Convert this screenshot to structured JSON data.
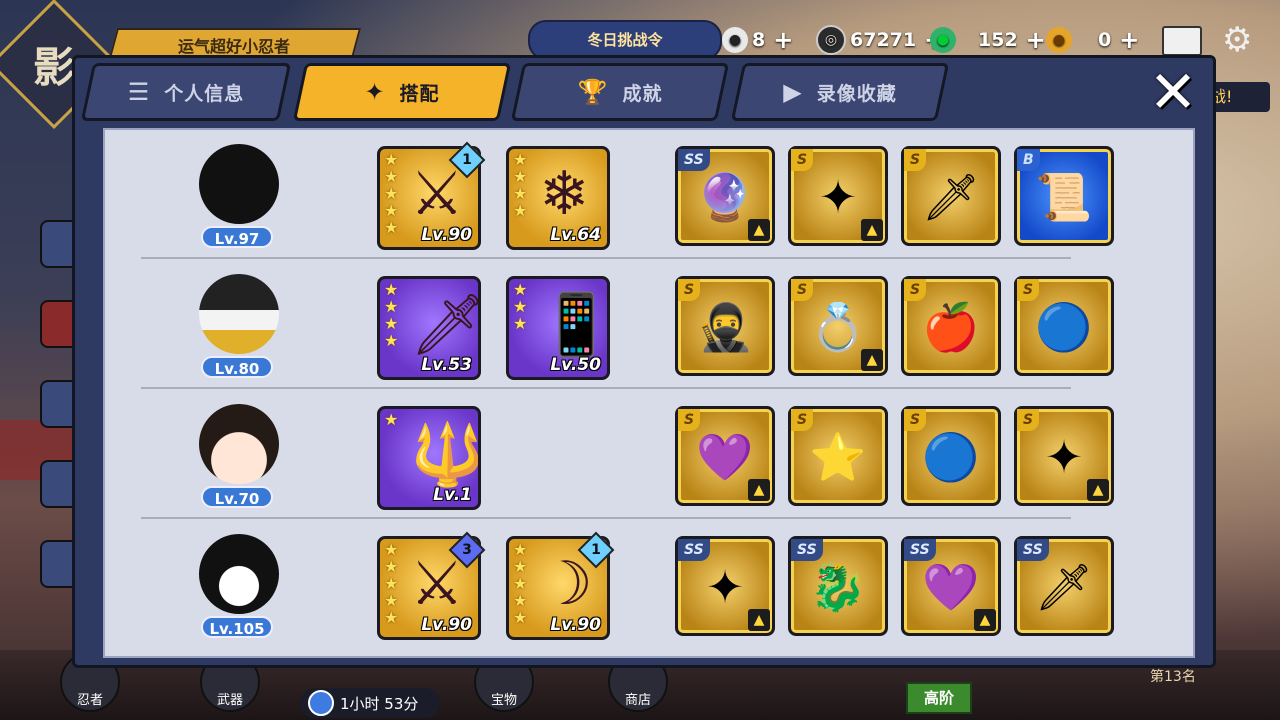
{
  "hud": {
    "logo_char": "影",
    "player_title": "运气超好小忍者",
    "event_label": "冬日挑战令",
    "resources": [
      {
        "name": "rice-ball",
        "value": "8",
        "color": "#f2f2f2"
      },
      {
        "name": "coin",
        "value": "67271",
        "color": "#333333"
      },
      {
        "name": "jade",
        "value": "152",
        "color": "#2fb36a"
      },
      {
        "name": "map-pin",
        "value": "0",
        "color": "#e6a52a"
      }
    ],
    "battle_text": "战!",
    "timer_text": "1小时 53分",
    "advanced_label": "高阶",
    "rank_text": "第13名",
    "bottom_tabs": [
      "忍者",
      "武器",
      "宝物",
      "商店"
    ]
  },
  "tabs": [
    {
      "label": "个人信息",
      "icon": "profile-icon",
      "active": false
    },
    {
      "label": "搭配",
      "icon": "shuriken-icon",
      "active": true
    },
    {
      "label": "成就",
      "icon": "trophy-icon",
      "active": false
    },
    {
      "label": "录像收藏",
      "icon": "play-icon",
      "active": false
    }
  ],
  "rows": [
    {
      "level": "Lv.97",
      "weapons": [
        {
          "stars": 5,
          "level": "Lv.90",
          "rarity": "gold",
          "gem": "1",
          "gem_color": "#6fd0ff",
          "art": "⚔"
        },
        {
          "stars": 4,
          "level": "Lv.64",
          "rarity": "gold",
          "gem": "",
          "gem_color": "",
          "art": "❄"
        }
      ],
      "treasures": [
        {
          "rank": "SS",
          "art": "🔮",
          "blue": false,
          "badge": true
        },
        {
          "rank": "S",
          "art": "✦",
          "blue": false,
          "badge": true
        },
        {
          "rank": "S",
          "art": "🗡",
          "blue": false,
          "badge": false
        },
        {
          "rank": "B",
          "art": "📜",
          "blue": true,
          "badge": false
        }
      ]
    },
    {
      "level": "Lv.80",
      "weapons": [
        {
          "stars": 4,
          "level": "Lv.53",
          "rarity": "purple",
          "gem": "",
          "gem_color": "",
          "art": "🗡"
        },
        {
          "stars": 3,
          "level": "Lv.50",
          "rarity": "purple",
          "gem": "",
          "gem_color": "",
          "art": "📱"
        }
      ],
      "treasures": [
        {
          "rank": "S",
          "art": "🥷",
          "blue": false,
          "badge": false
        },
        {
          "rank": "S",
          "art": "💍",
          "blue": false,
          "badge": true
        },
        {
          "rank": "S",
          "art": "🍎",
          "blue": false,
          "badge": false
        },
        {
          "rank": "S",
          "art": "🔵",
          "blue": false,
          "badge": false
        }
      ]
    },
    {
      "level": "Lv.70",
      "weapons": [
        {
          "stars": 1,
          "level": "Lv.1",
          "rarity": "purple",
          "gem": "",
          "gem_color": "",
          "art": "🔱"
        }
      ],
      "treasures": [
        {
          "rank": "S",
          "art": "💜",
          "blue": false,
          "badge": true
        },
        {
          "rank": "S",
          "art": "⭐",
          "blue": false,
          "badge": false
        },
        {
          "rank": "S",
          "art": "🔵",
          "blue": false,
          "badge": false
        },
        {
          "rank": "S",
          "art": "✦",
          "blue": false,
          "badge": true
        }
      ]
    },
    {
      "level": "Lv.105",
      "weapons": [
        {
          "stars": 5,
          "level": "Lv.90",
          "rarity": "gold",
          "gem": "3",
          "gem_color": "#5b6cf0",
          "art": "⚔"
        },
        {
          "stars": 5,
          "level": "Lv.90",
          "rarity": "gold",
          "gem": "1",
          "gem_color": "#6fd0ff",
          "art": "☽"
        }
      ],
      "treasures": [
        {
          "rank": "SS",
          "art": "✦",
          "blue": false,
          "badge": true
        },
        {
          "rank": "SS",
          "art": "🐉",
          "blue": false,
          "badge": false
        },
        {
          "rank": "SS",
          "art": "💜",
          "blue": false,
          "badge": true
        },
        {
          "rank": "SS",
          "art": "🗡",
          "blue": false,
          "badge": false
        }
      ]
    }
  ],
  "close_glyph": "✕"
}
